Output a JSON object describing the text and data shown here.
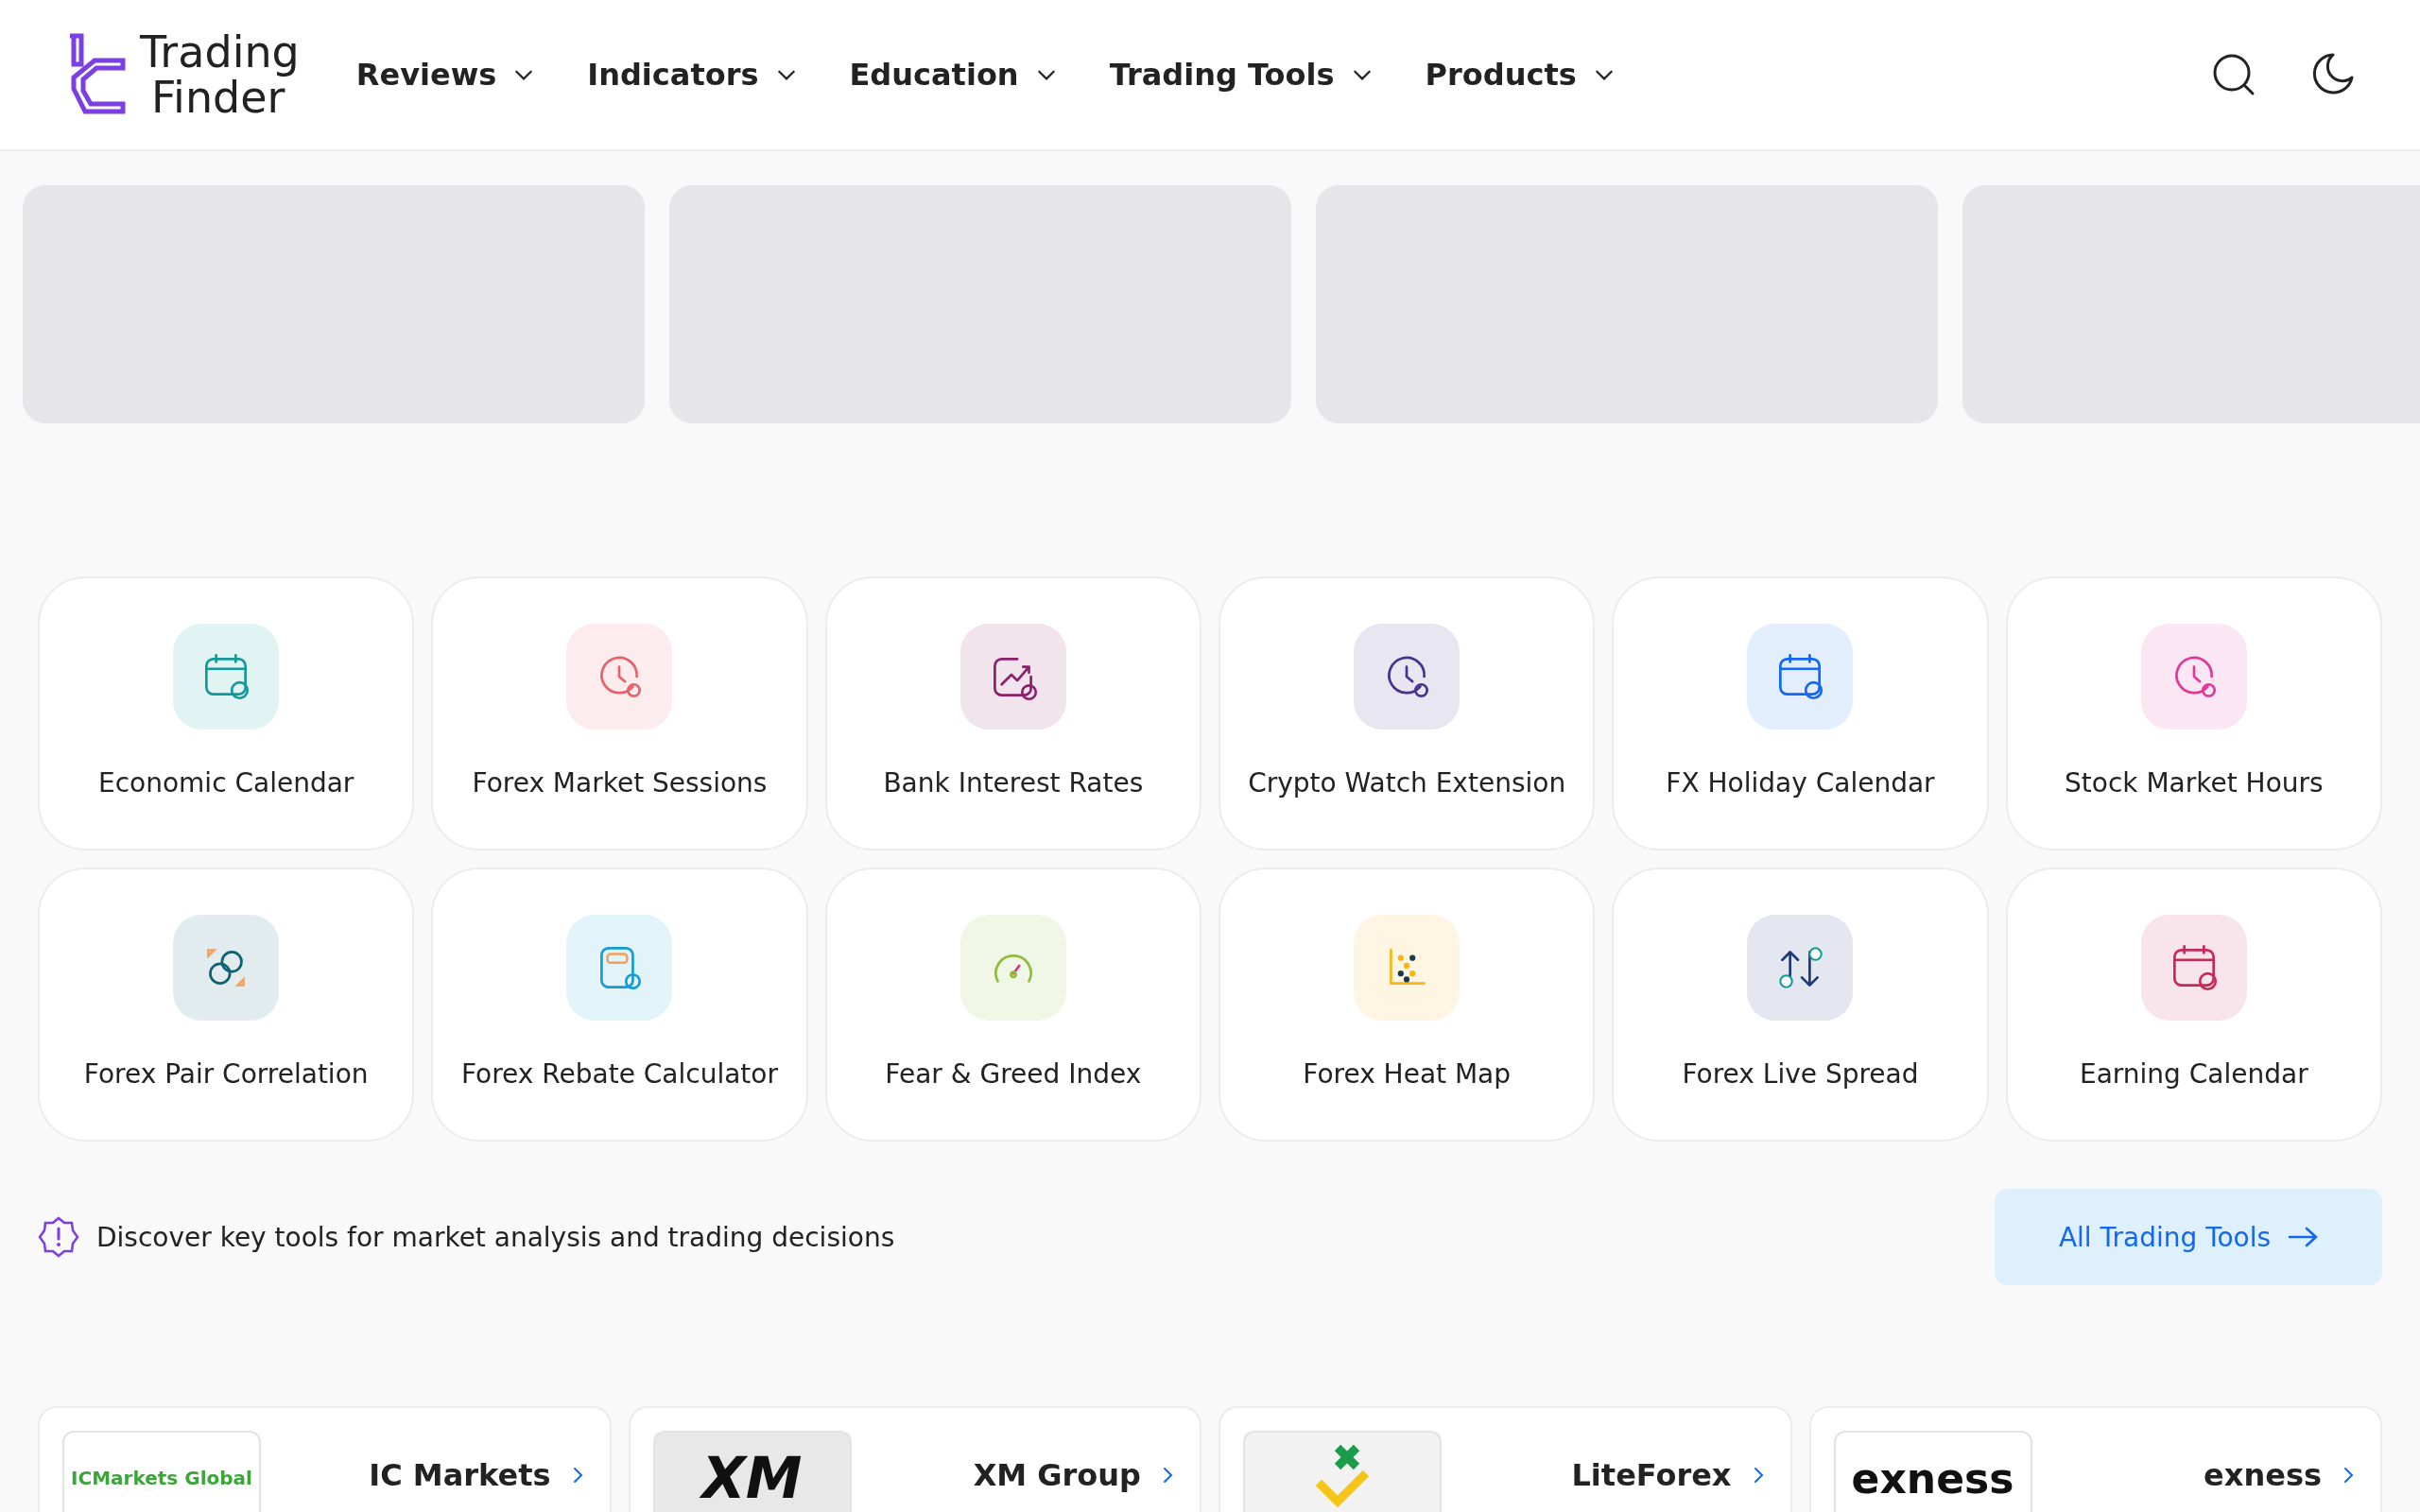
{
  "header": {
    "logo": [
      "Trading",
      "Finder"
    ],
    "nav": [
      {
        "label": "Reviews"
      },
      {
        "label": "Indicators"
      },
      {
        "label": "Education"
      },
      {
        "label": "Trading Tools"
      },
      {
        "label": "Products"
      }
    ]
  },
  "banners": [
    {
      "kind": "placeholder"
    },
    {
      "kind": "placeholder"
    },
    {
      "kind": "placeholder"
    },
    {
      "kind": "placeholder"
    }
  ],
  "tools": [
    {
      "label": "Economic Calendar",
      "kind": "calendar",
      "color": "#14999a"
    },
    {
      "label": "Forex Market Sessions",
      "kind": "clock",
      "color": "#e8606a"
    },
    {
      "label": "Bank Interest Rates",
      "kind": "chart",
      "color": "#8e1f6b"
    },
    {
      "label": "Crypto Watch Extension",
      "kind": "clock",
      "color": "#45338f"
    },
    {
      "label": "FX Holiday Calendar",
      "kind": "calendar",
      "color": "#1268f3"
    },
    {
      "label": "Stock Market Hours",
      "kind": "clock",
      "color": "#e0389a"
    },
    {
      "label": "Forex Pair Correlation",
      "kind": "circles",
      "color": "#0f6072"
    },
    {
      "label": "Forex Rebate Calculator",
      "kind": "calculator",
      "color": "#169bd7"
    },
    {
      "label": "Fear & Greed Index",
      "kind": "gauge",
      "color": "#8ebd3c"
    },
    {
      "label": "Forex Heat Map",
      "kind": "dots",
      "color": "#f5b617"
    },
    {
      "label": "Forex Live Spread",
      "kind": "arrows",
      "color": "#1d3a7a"
    },
    {
      "label": "Earning Calendar",
      "kind": "calendar",
      "color": "#c72a57"
    }
  ],
  "info": {
    "text": "Discover key tools for market analysis and trading decisions",
    "button": "All Trading Tools"
  },
  "brokers": [
    {
      "name": "IC Markets",
      "logo": "ICMarkets Global"
    },
    {
      "name": "XM Group",
      "logo": "XM"
    },
    {
      "name": "LiteForex"
    },
    {
      "name": "exness",
      "logo": "exness"
    }
  ]
}
